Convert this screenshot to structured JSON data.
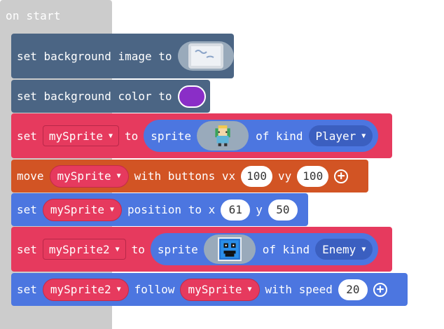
{
  "hat": {
    "label": "on start"
  },
  "blocks": {
    "set_bg_image": {
      "text": "set background image to"
    },
    "set_bg_color": {
      "text": "set background color to",
      "color": "#8a2ec7"
    },
    "set_sprite1": {
      "set": "set",
      "var": "mySprite",
      "to": "to",
      "sprite": "sprite",
      "of_kind": "of kind",
      "kind": "Player"
    },
    "move": {
      "move": "move",
      "var": "mySprite",
      "with_buttons": "with buttons vx",
      "vx": "100",
      "vy_label": "vy",
      "vy": "100"
    },
    "position": {
      "set": "set",
      "var": "mySprite",
      "position_to": "position to x",
      "x": "61",
      "y_label": "y",
      "y": "50"
    },
    "set_sprite2": {
      "set": "set",
      "var": "mySprite2",
      "to": "to",
      "sprite": "sprite",
      "of_kind": "of kind",
      "kind": "Enemy"
    },
    "follow": {
      "set": "set",
      "var": "mySprite2",
      "follow": "follow",
      "target": "mySprite",
      "with_speed": "with speed",
      "speed": "20"
    }
  },
  "colors": {
    "scene": "#4b6584",
    "sprites": "#e63a5e",
    "control": "#d25424",
    "motion": "#4c76e0",
    "hat": "#cccccc"
  },
  "icons": [
    "dropdown-caret-icon",
    "plus-icon",
    "player-sprite-image",
    "enemy-sprite-image",
    "background-image-thumbnail"
  ]
}
